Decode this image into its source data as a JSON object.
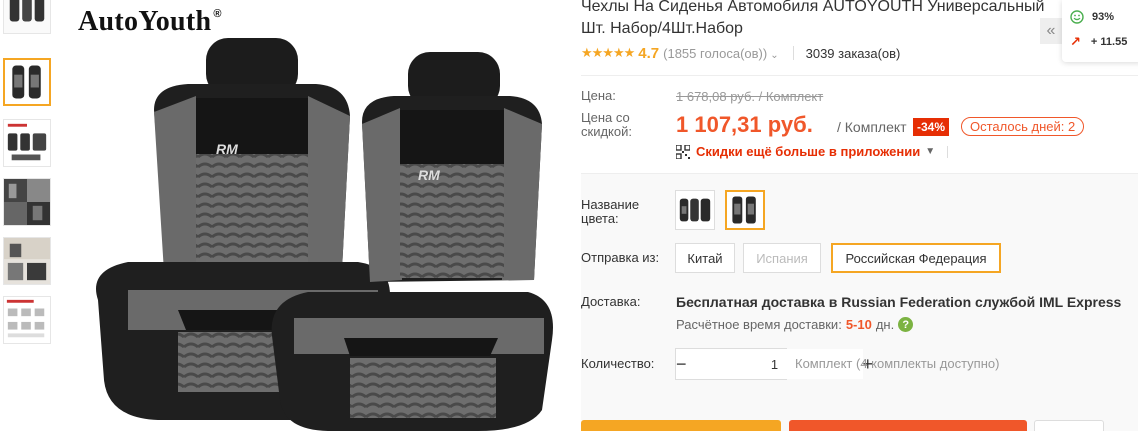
{
  "brand": {
    "name": "AutoYouth",
    "registered": "®"
  },
  "product": {
    "title": "Чехлы На Сиденья Автомобиля AUTOYOUTH Универсальный Шт. Набор/4Шт.Набор",
    "rating": "4.7",
    "votes": "(1855 голоса(ов))",
    "orders": "3039 заказа(ов)",
    "stars": "★★★★★"
  },
  "price": {
    "label": "Цена:",
    "old_price": "1 678,08 руб. / Комплект",
    "discount_label": "Цена со скидкой:",
    "new_price": "1 107,31 руб.",
    "per": "/ Комплект",
    "discount": "-34%",
    "days_left": "Осталось дней: 2",
    "app_deal": "Скидки ещё больше в приложении"
  },
  "options": {
    "color_label": "Название цвета:",
    "ship_from_label": "Отправка из:",
    "ship_from": [
      {
        "label": "Китай",
        "state": "normal"
      },
      {
        "label": "Испания",
        "state": "disabled"
      },
      {
        "label": "Российская Федерация",
        "state": "selected"
      }
    ]
  },
  "delivery": {
    "label": "Доставка:",
    "free_text": "Бесплатная доставка в",
    "location": "Russian Federation",
    "service": "службой IML Express",
    "est_label": "Расчётное время доставки:",
    "days": "5-10",
    "days_unit": "дн.",
    "help": "?"
  },
  "quantity": {
    "label": "Количество:",
    "value": "1",
    "minus": "−",
    "plus": "+",
    "available": "Комплект (4 комплекты доступно)"
  },
  "widget": {
    "positive": "93%",
    "growth": "+ 11.55",
    "collapse": "«"
  },
  "seat_logo": "RM",
  "colors": {
    "accent": "#f5a623",
    "price": "#f0572a",
    "discount_bg": "#e62e04"
  }
}
